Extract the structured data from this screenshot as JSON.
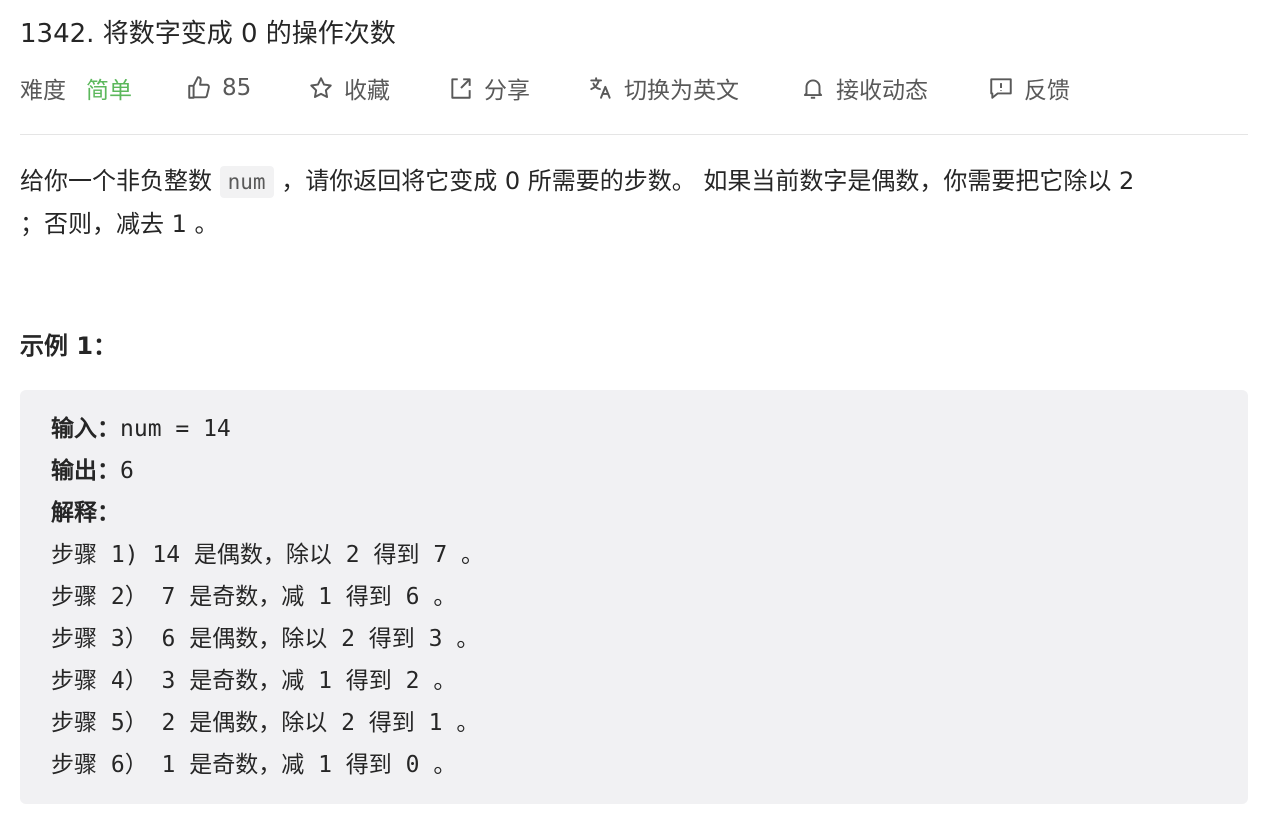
{
  "problem": {
    "title": "1342. 将数字变成 0 的操作次数"
  },
  "meta": {
    "difficulty_label": "难度",
    "difficulty_value": "简单",
    "likes": "85",
    "favorite": "收藏",
    "share": "分享",
    "switch_lang": "切换为英文",
    "subscribe": "接收动态",
    "feedback": "反馈",
    "colors": {
      "easy": "#5cb85c",
      "meta_text": "#595959"
    },
    "icons": [
      "thumbs-up-icon",
      "star-icon",
      "share-icon",
      "translate-icon",
      "bell-icon",
      "feedback-icon"
    ]
  },
  "description": {
    "part1": "给你一个非负整数",
    "code": "num",
    "part2": "，请你返回将它变成 0 所需要的步数。 如果当前数字是偶数，你需要把它除以 2",
    "part3": "；否则，减去 1 。"
  },
  "example": {
    "title": "示例 1：",
    "input_label": "输入：",
    "input_value": "num = 14",
    "output_label": "输出：",
    "output_value": "6",
    "explain_label": "解释：",
    "steps": [
      "步骤 1) 14 是偶数，除以 2 得到 7 。",
      "步骤 2） 7 是奇数，减 1 得到 6 。",
      "步骤 3） 6 是偶数，除以 2 得到 3 。",
      "步骤 4） 3 是奇数，减 1 得到 2 。",
      "步骤 5） 2 是偶数，除以 2 得到 1 。",
      "步骤 6） 1 是奇数，减 1 得到 0 。"
    ]
  }
}
